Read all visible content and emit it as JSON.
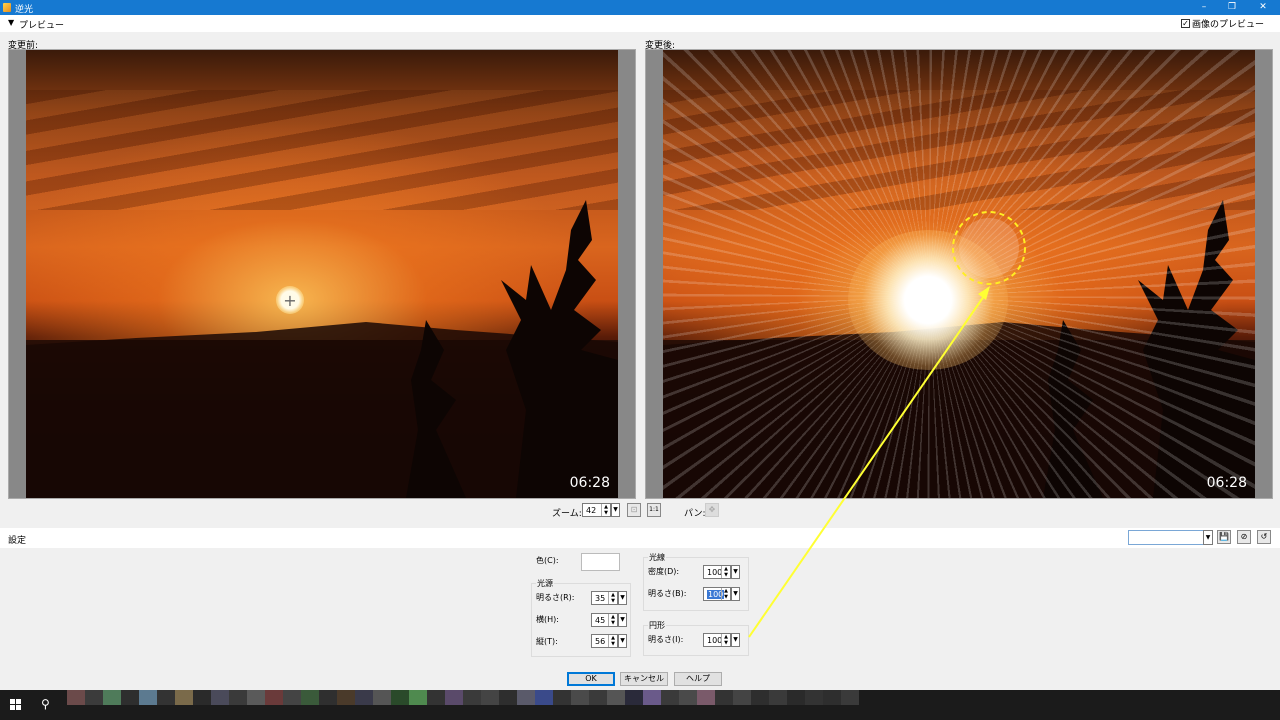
{
  "window": {
    "title": "逆光",
    "min": "–",
    "max": "❐",
    "close": "✕"
  },
  "preview": {
    "toggle_glyph": "▼",
    "label": "プレビュー",
    "show_image_label": "画像のプレビュー",
    "show_image_checked": true,
    "before_label": "変更前:",
    "after_label": "変更後:",
    "timestamp": "06:28"
  },
  "zoom": {
    "label": "ズーム:",
    "value": "42",
    "pan_label": "パン:"
  },
  "settings": {
    "label": "設定",
    "color_label": "色(C):",
    "light_source": {
      "group_label": "光源",
      "brightness_label": "明るさ(R):",
      "brightness": "35",
      "horizontal_label": "横(H):",
      "horizontal": "45",
      "vertical_label": "縦(T):",
      "vertical": "56"
    },
    "rays": {
      "group_label": "光線",
      "density_label": "密度(D):",
      "density": "100",
      "brightness_label": "明るさ(B):",
      "brightness": "100"
    },
    "circle": {
      "group_label": "円形",
      "brightness_label": "明るさ(I):",
      "brightness": "100"
    }
  },
  "buttons": {
    "ok": "OK",
    "cancel": "キャンセル",
    "help": "ヘルプ"
  },
  "icons": {
    "save": "💾",
    "delete": "⊘",
    "reset": "↺",
    "fit": "⊡",
    "actual": "1:1",
    "pan": "✥",
    "search": "⚲"
  },
  "colors": {
    "titlebar": "#1679d1",
    "annotation": "#ffff33",
    "default_button_border": "#0078d7"
  }
}
